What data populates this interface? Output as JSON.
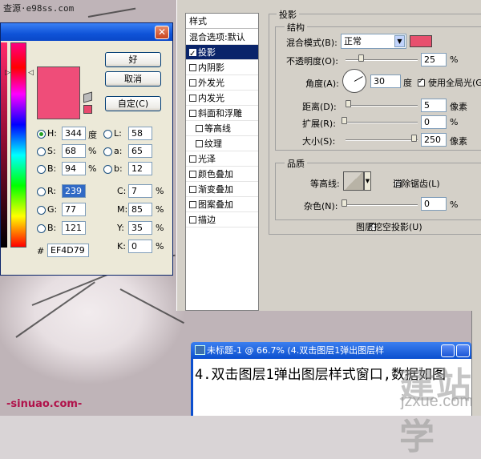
{
  "watermark_top": "查源·e98ss.com",
  "picker": {
    "ok_label": "好",
    "cancel_label": "取消",
    "custom_label": "自定(C)",
    "hsb": [
      {
        "label": "H:",
        "value": "344",
        "unit": "度",
        "selected": true
      },
      {
        "label": "S:",
        "value": "68",
        "unit": "%",
        "selected": false
      },
      {
        "label": "B:",
        "value": "94",
        "unit": "%",
        "selected": false
      }
    ],
    "lab": [
      {
        "label": "L:",
        "value": "58"
      },
      {
        "label": "a:",
        "value": "65"
      },
      {
        "label": "b:",
        "value": "12"
      }
    ],
    "rgb": [
      {
        "label": "R:",
        "value": "239"
      },
      {
        "label": "G:",
        "value": "77"
      },
      {
        "label": "B:",
        "value": "121"
      }
    ],
    "cmyk": [
      {
        "label": "C:",
        "value": "7",
        "unit": "%"
      },
      {
        "label": "M:",
        "value": "85",
        "unit": "%"
      },
      {
        "label": "Y:",
        "value": "35",
        "unit": "%"
      },
      {
        "label": "K:",
        "value": "0",
        "unit": "%"
      }
    ],
    "hex_label": "#",
    "hex_value": "EF4D79",
    "current_color": "#ef4d79"
  },
  "layer_style": {
    "list_header": "样式",
    "items": [
      {
        "label": "混合选项:默认",
        "checkbox": false,
        "checked": false,
        "selected": false,
        "indent": false
      },
      {
        "label": "投影",
        "checkbox": true,
        "checked": true,
        "selected": true,
        "indent": false
      },
      {
        "label": "内阴影",
        "checkbox": true,
        "checked": false,
        "selected": false,
        "indent": false
      },
      {
        "label": "外发光",
        "checkbox": true,
        "checked": false,
        "selected": false,
        "indent": false
      },
      {
        "label": "内发光",
        "checkbox": true,
        "checked": false,
        "selected": false,
        "indent": false
      },
      {
        "label": "斜面和浮雕",
        "checkbox": true,
        "checked": false,
        "selected": false,
        "indent": false
      },
      {
        "label": "等高线",
        "checkbox": true,
        "checked": false,
        "selected": false,
        "indent": true
      },
      {
        "label": "纹理",
        "checkbox": true,
        "checked": false,
        "selected": false,
        "indent": true
      },
      {
        "label": "光泽",
        "checkbox": true,
        "checked": false,
        "selected": false,
        "indent": false
      },
      {
        "label": "颜色叠加",
        "checkbox": true,
        "checked": false,
        "selected": false,
        "indent": false
      },
      {
        "label": "渐变叠加",
        "checkbox": true,
        "checked": false,
        "selected": false,
        "indent": false
      },
      {
        "label": "图案叠加",
        "checkbox": true,
        "checked": false,
        "selected": false,
        "indent": false
      },
      {
        "label": "描边",
        "checkbox": true,
        "checked": false,
        "selected": false,
        "indent": false
      }
    ],
    "drop_shadow_title": "投影",
    "structure_title": "结构",
    "blend_mode_label": "混合模式(B):",
    "blend_mode_value": "正常",
    "shadow_color": "#e8506e",
    "opacity_label": "不透明度(O):",
    "opacity_value": "25",
    "opacity_unit": "%",
    "angle_label": "角度(A):",
    "angle_value": "30",
    "angle_unit": "度",
    "global_light_label": "使用全局光(G)",
    "global_light_checked": true,
    "distance_label": "距离(D):",
    "distance_value": "5",
    "distance_unit": "像素",
    "spread_label": "扩展(R):",
    "spread_value": "0",
    "spread_unit": "%",
    "size_label": "大小(S):",
    "size_value": "250",
    "size_unit": "像素",
    "quality_title": "品质",
    "contour_label": "等高线:",
    "antialias_label": "消除锯齿(L)",
    "antialias_checked": false,
    "noise_label": "杂色(N):",
    "noise_value": "0",
    "noise_unit": "%",
    "knockout_label": "图层挖空投影(U)",
    "knockout_checked": true
  },
  "document": {
    "title": "未标题-1 @ 66.7% (4.双击图层1弹出图层样",
    "caption": "4.双击图层1弹出图层样式窗口,数据如图"
  },
  "site_watermark": "建站学",
  "site_url": "jzxue.com",
  "bottom_logo": "-sinuao.com-"
}
